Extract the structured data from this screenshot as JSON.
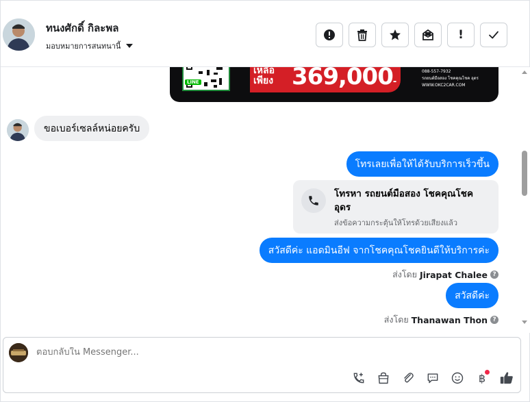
{
  "header": {
    "user_name": "ทนงศักดิ์ กิละพล",
    "assign_label": "มอบหมายการสนทนานี้",
    "actions": [
      {
        "name": "spam-button",
        "icon": "alert-circle-icon"
      },
      {
        "name": "delete-button",
        "icon": "trash-icon"
      },
      {
        "name": "star-button",
        "icon": "star-icon"
      },
      {
        "name": "mark-unread-button",
        "icon": "envelope-open-icon"
      },
      {
        "name": "follow-up-button",
        "icon": "exclamation-icon",
        "glyph": "!"
      },
      {
        "name": "mark-done-button",
        "icon": "check-icon"
      }
    ]
  },
  "banner": {
    "price_prefix_1": "เหลือ",
    "price_prefix_2": "เพียง",
    "price": "369,000",
    "currency": "-",
    "qr_label": "LINE",
    "contact_lines": [
      "088-557-7932",
      "รถยนต์มือสอง โชคคุณโชค อุดร",
      "WWW.OKC2CAR.COM"
    ]
  },
  "messages": {
    "incoming_1": "ขอเบอร์เซลล์หน่อยครับ",
    "outgoing_1": "โทรเลยเพื่อให้ได้รับบริการเร็วขึ้น",
    "call_card": {
      "title": "โทรหา รถยนต์มือสอง โชคคุณโชค อุดร",
      "subtitle": "ส่งข้อความกระตุ้นให้โทรด้วยเสียงแล้ว"
    },
    "outgoing_2": "สวัสดีค่ะ แอดมินอีฟ จากโชคคุณโชคยินดีให้บริการค่ะ",
    "sent_by_prefix": "ส่งโดย",
    "sent_by_1": "Jirapat Chalee",
    "outgoing_3": "สวัสดีค่ะ",
    "sent_by_2": "Thanawan Thon",
    "help_glyph": "?"
  },
  "composer": {
    "placeholder": "ตอบกลับใน Messenger...",
    "tools": [
      "phone-add-icon",
      "shopping-bag-icon",
      "paperclip-icon",
      "chat-bubble-icon",
      "emoji-icon",
      "baht-icon",
      "thumbs-up-icon"
    ],
    "baht_glyph": "฿"
  },
  "colors": {
    "accent": "#0a7cff",
    "incoming_bubble": "#eff0f2",
    "promo_red": "#d41f26",
    "notification_dot": "#f02849"
  }
}
